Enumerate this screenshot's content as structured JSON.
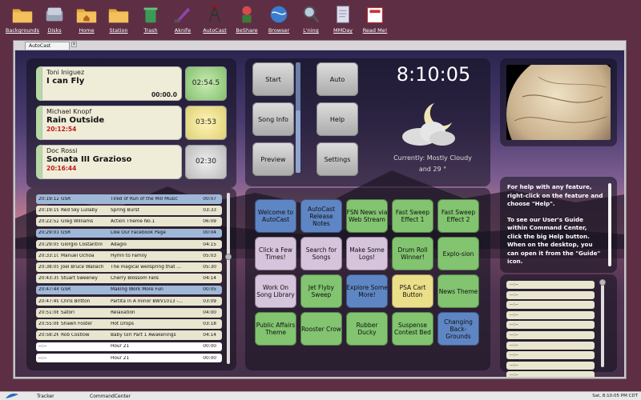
{
  "desktop": {
    "icons": [
      {
        "label": "Backgrounds",
        "icon": "folder-icon"
      },
      {
        "label": "Disks",
        "icon": "disks-icon"
      },
      {
        "label": "Home",
        "icon": "home-folder-icon"
      },
      {
        "label": "Station",
        "icon": "folder-icon"
      },
      {
        "label": "Trash",
        "icon": "trash-icon"
      },
      {
        "label": "Aknife",
        "icon": "knife-icon"
      },
      {
        "label": "AutoCast",
        "icon": "antenna-icon"
      },
      {
        "label": "BeShare",
        "icon": "plant-icon"
      },
      {
        "label": "Browser",
        "icon": "globe-icon"
      },
      {
        "label": "L'ning",
        "icon": "magnifier-icon"
      },
      {
        "label": "MMDay",
        "icon": "doc-icon"
      },
      {
        "label": "Read Me!",
        "icon": "newspaper-icon"
      }
    ]
  },
  "window": {
    "tab_title": "AutoCast"
  },
  "carts": [
    {
      "artist": "Toni Iniguez",
      "title": "I can Fly",
      "remaining": "",
      "position": "00:00.0",
      "duration": "02:54.5",
      "status": "playing"
    },
    {
      "artist": "Michael Knopf",
      "title": "Rain Outside",
      "remaining": "20:12:54",
      "position": "",
      "duration": "03:53",
      "status": "cued"
    },
    {
      "artist": "Doc Rossi",
      "title": "Sonata III Grazioso",
      "remaining": "20:16:44",
      "position": "",
      "duration": "02:30",
      "status": "idle"
    }
  ],
  "log": {
    "rows": [
      {
        "time": "20:19:12",
        "artist": "GSR",
        "title": "Tired of Run of the Mill Music",
        "dur": "00:07",
        "kind": "b"
      },
      {
        "time": "20:19:19",
        "artist": "Red Sky Lullaby",
        "title": "Spring Burst",
        "dur": "03:33",
        "kind": "a"
      },
      {
        "time": "20:22:52",
        "artist": "Greg Williams",
        "title": "Action Theme No.1",
        "dur": "06:09",
        "kind": "a"
      },
      {
        "time": "20:29:01",
        "artist": "GSR",
        "title": "Like Our Facebook Page",
        "dur": "00:04",
        "kind": "b"
      },
      {
        "time": "20:29:05",
        "artist": "Giorgio Costantini",
        "title": "Adagio",
        "dur": "04:15",
        "kind": "a"
      },
      {
        "time": "20:33:10",
        "artist": "Manuel Ochoa",
        "title": "Hymn to Family",
        "dur": "05:03",
        "kind": "a"
      },
      {
        "time": "20:38:05",
        "artist": "Joel Bruce Wallach",
        "title": "The magical wellspring that ...",
        "dur": "05:30",
        "kind": "a"
      },
      {
        "time": "20:43:35",
        "artist": "Stuart Sweeney",
        "title": "Cherry Blossom Falls",
        "dur": "04:14",
        "kind": "a"
      },
      {
        "time": "20:47:44",
        "artist": "GSR",
        "title": "Making Work More Fun",
        "dur": "00:05",
        "kind": "b"
      },
      {
        "time": "20:47:49",
        "artist": "Chris Britton",
        "title": "Partita in A minor BWV1013 -...",
        "dur": "03:09",
        "kind": "a"
      },
      {
        "time": "20:51:08",
        "artist": "Satori",
        "title": "Relaxation",
        "dur": "04:00",
        "kind": "a"
      },
      {
        "time": "20:55:08",
        "artist": "Shawn Foster",
        "title": "Hot Drops",
        "dur": "03:18",
        "kind": "a"
      },
      {
        "time": "20:58:26",
        "artist": "Rob Costlow",
        "title": "Baby Girl Part 1 Awakenings",
        "dur": "04:14",
        "kind": "a"
      },
      {
        "time": "--:--",
        "artist": "",
        "title": "Hour 21",
        "dur": "00:00",
        "kind": "d"
      },
      {
        "time": "--:--",
        "artist": "",
        "title": "Hour 21",
        "dur": "00:00",
        "kind": "d"
      }
    ]
  },
  "controls": {
    "start": "Start",
    "song_info": "Song Info",
    "preview": "Preview",
    "auto": "Auto",
    "help": "Help",
    "settings": "Settings"
  },
  "clock": {
    "time": "8:10:05"
  },
  "weather": {
    "line1": "Currently: Mostly Cloudy",
    "line2": "and 29 °",
    "icon": "moon-cloud-icon"
  },
  "grid": [
    {
      "label": "Welcome to AutoCast",
      "color": "b"
    },
    {
      "label": "AutoCast Release Notes",
      "color": "b"
    },
    {
      "label": "FSN News via Web Stream",
      "color": "g"
    },
    {
      "label": "Fast Sweep Effect 1",
      "color": "g"
    },
    {
      "label": "Fast Sweep Effect 2",
      "color": "g"
    },
    {
      "label": "Click a Few Times!",
      "color": "p"
    },
    {
      "label": "Search for Songs",
      "color": "p"
    },
    {
      "label": "Make Some Logs!",
      "color": "p"
    },
    {
      "label": "Drum Roll Winner!",
      "color": "g"
    },
    {
      "label": "Explo-sion",
      "color": "g"
    },
    {
      "label": "Work On Song Library",
      "color": "p"
    },
    {
      "label": "Jet Flyby Sweep",
      "color": "g"
    },
    {
      "label": "Explore Some More!",
      "color": "b"
    },
    {
      "label": "PSA Cart Button",
      "color": "y"
    },
    {
      "label": "News Theme",
      "color": "g"
    },
    {
      "label": "Public Affairs Theme",
      "color": "g"
    },
    {
      "label": "Rooster Crow",
      "color": "g"
    },
    {
      "label": "Rubber Ducky",
      "color": "g"
    },
    {
      "label": "Suspense Contest Bed",
      "color": "g"
    },
    {
      "label": "Changing Back-Grounds",
      "color": "b"
    }
  ],
  "help": {
    "p1": "For help with any feature, right-click on the feature and choose \"Help\".",
    "p2": "To see our User's Guide within Command Center, click the big Help button. When on the desktop, you can open it from the \"Guide\" icon."
  },
  "queue": {
    "rows": [
      "--:--",
      "--:--",
      "--:--",
      "--:--",
      "--:--",
      "--:--",
      "--:--",
      "--:--",
      "--:--",
      "--:--"
    ]
  },
  "taskbar": {
    "items": [
      {
        "label": "Tracker"
      },
      {
        "label": "CommandCenter"
      }
    ],
    "clock": "Sat, 8:10:05 PM CDT"
  }
}
